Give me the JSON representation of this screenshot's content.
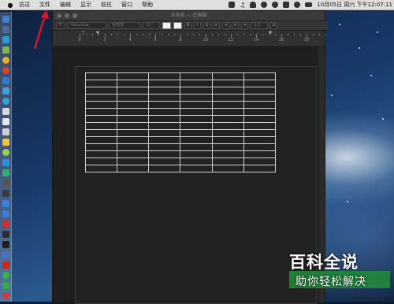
{
  "menubar": {
    "app": "访达",
    "items": [
      "文件",
      "编辑",
      "显示",
      "前往",
      "窗口",
      "帮助"
    ],
    "clock": "10月05日 周六 下午12:07:11"
  },
  "window": {
    "title": "未命名 — 已编辑",
    "toolbar": {
      "paragraph_style": "¶",
      "font_family": "Helvetica",
      "font_style": "常规体",
      "font_size": "12",
      "bold": "B",
      "italic": "I",
      "underline": "U",
      "line_spacing": "1.0"
    },
    "ruler": [
      "0",
      "2",
      "4",
      "6",
      "8",
      "10",
      "12",
      "14",
      "16",
      "18"
    ]
  },
  "table": {
    "rows": 14,
    "cols": 6
  },
  "watermark": {
    "title": "百科全说",
    "subtitle": "助你轻松解决"
  }
}
